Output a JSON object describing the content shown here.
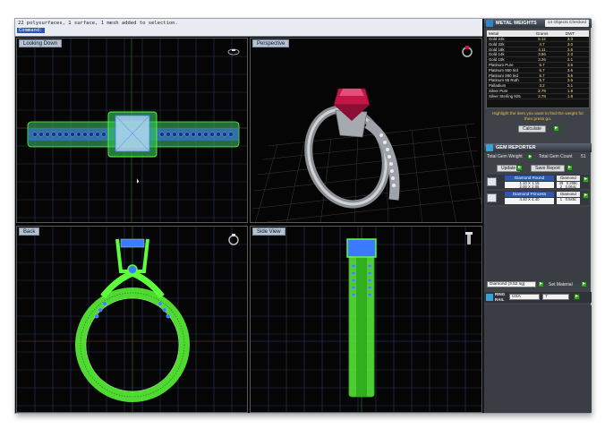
{
  "command": {
    "line1": "22 polysurfaces, 1 surface, 1 mesh added to selection.",
    "line2": "Command:"
  },
  "viewports": {
    "top": "Looking Down",
    "perspective": "Perspective",
    "back": "Back",
    "side": "Side View"
  },
  "metal_weights": {
    "title": "METAL WEIGHTS",
    "badge": "14 Objects Checked",
    "columns": [
      "Metal",
      "Grams",
      "DWT"
    ],
    "rows": [
      [
        "Gold 24k",
        "5.12",
        "3.3"
      ],
      [
        "Gold 22k",
        "4.7",
        "3.0"
      ],
      [
        "Gold 18k",
        "4.11",
        "2.6"
      ],
      [
        "Gold 14k",
        "3.56",
        "2.3"
      ],
      [
        "Gold 10k",
        "3.26",
        "2.1"
      ],
      [
        "Platinum Pure",
        "5.7",
        "3.6"
      ],
      [
        "Platinum 950 Iird",
        "5.7",
        "3.6"
      ],
      [
        "Platinum 900 Iird",
        "5.7",
        "3.6"
      ],
      [
        "Platinum 95 Ruth",
        "5.7",
        "3.6"
      ],
      [
        "Palladium",
        "3.2",
        "2.1"
      ],
      [
        "Silver Pure",
        "2.79",
        "1.8"
      ],
      [
        "Silver Sterling 925",
        "2.78",
        "1.8"
      ]
    ],
    "hint": "Highlight the item you want to find the weight for then press go.",
    "calculate_label": "Calculate"
  },
  "gem_reporter": {
    "title": "GEM REPORTER",
    "total_weight_label": "Total Gem Weight",
    "total_count_label": "Total Gem Count",
    "total_count_value": "51",
    "update_label": "Update",
    "save_report_label": "Save Report",
    "gems": [
      {
        "name": "Diamond Round",
        "size": "1.10 X 1.15\n2.00 X 2.05",
        "type": "Diamond",
        "qty": "49   0.286c\n2   0.064c"
      },
      {
        "name": "Diamond Princess",
        "size": "4.40 X 4.40",
        "type": "Diamond",
        "qty": "1   0.545c"
      }
    ],
    "material_select": "Diamond (3.52 sg)",
    "set_material_label": "Set Material"
  },
  "ring_size": {
    "label1": "RING",
    "label2": "RAIL",
    "region": "USA",
    "size": "7"
  },
  "colors": {
    "wire": "#5dff3a",
    "wire_blue": "#3a7bff",
    "grid": "#2e3d5a",
    "ruby": "#c31646"
  }
}
